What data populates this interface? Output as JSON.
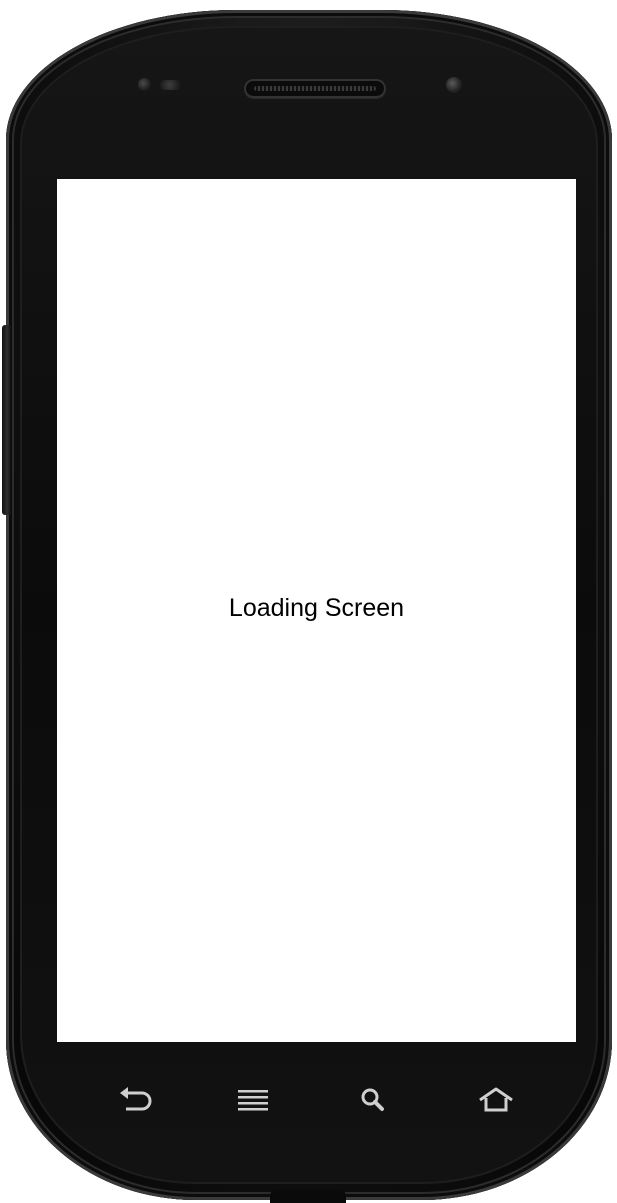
{
  "screen": {
    "message": "Loading Screen",
    "background_color": "#ffffff",
    "text_color": "#000000"
  },
  "device": {
    "bezel_color": "#0b0b0b"
  },
  "nav_buttons": [
    {
      "name": "back",
      "icon": "back-arrow-icon"
    },
    {
      "name": "menu",
      "icon": "menu-lines-icon"
    },
    {
      "name": "search",
      "icon": "search-icon"
    },
    {
      "name": "home",
      "icon": "home-icon"
    }
  ]
}
